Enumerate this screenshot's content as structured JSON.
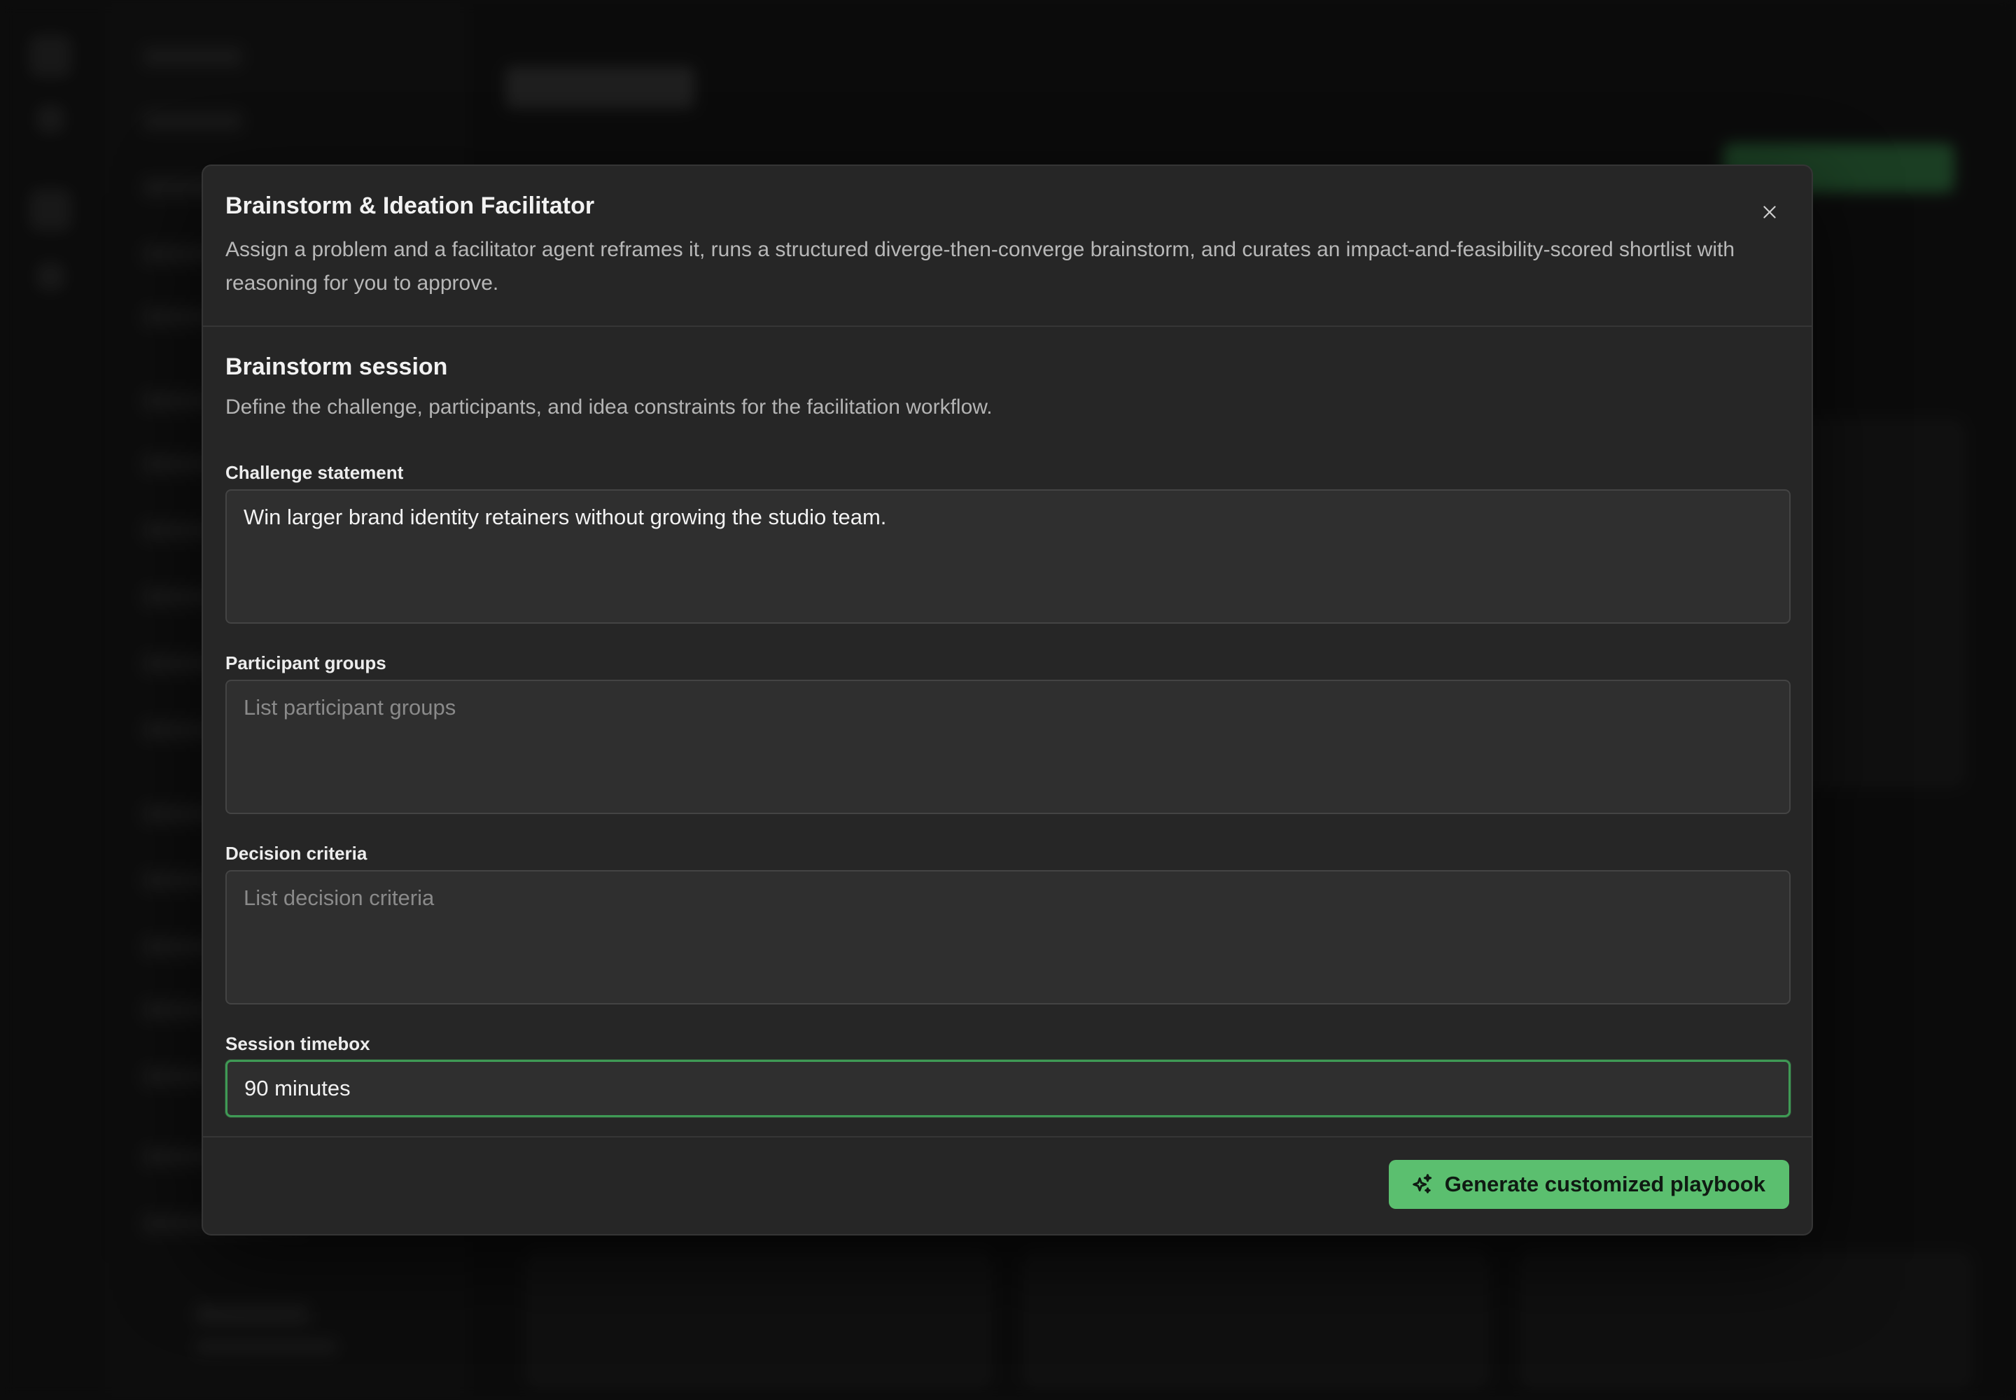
{
  "modal": {
    "title": "Brainstorm & Ideation Facilitator",
    "description": "Assign a problem and a facilitator agent reframes it, runs a structured diverge-then-converge brainstorm, and curates an impact-and-feasibility-scored shortlist with reasoning for you to approve.",
    "close_icon": "close-icon"
  },
  "section": {
    "title": "Brainstorm session",
    "description": "Define the challenge, participants, and idea constraints for the facilitation workflow."
  },
  "fields": {
    "challenge": {
      "label": "Challenge statement",
      "value": "Win larger brand identity retainers without growing the studio team.",
      "placeholder": ""
    },
    "participants": {
      "label": "Participant groups",
      "value": "",
      "placeholder": "List participant groups"
    },
    "criteria": {
      "label": "Decision criteria",
      "value": "",
      "placeholder": "List decision criteria"
    },
    "timebox": {
      "label": "Session timebox",
      "value": "90 minutes",
      "placeholder": ""
    }
  },
  "footer": {
    "generate_label": "Generate customized playbook",
    "generate_icon": "sparkles-icon"
  },
  "colors": {
    "accent": "#5bbf6f",
    "focus_border": "#3f9a55",
    "modal_bg": "#262626"
  }
}
